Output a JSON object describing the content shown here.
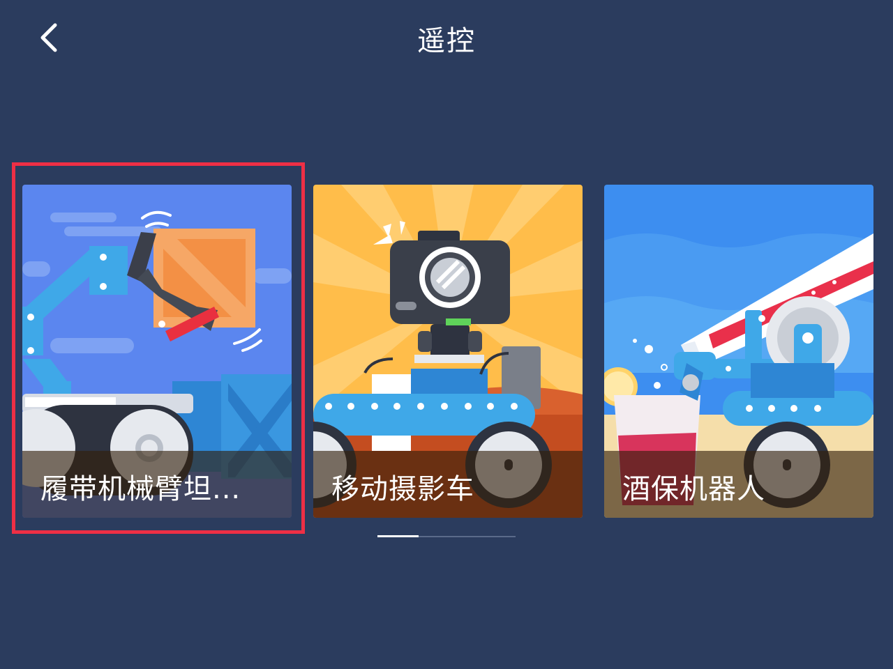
{
  "header": {
    "title": "遥控",
    "back_icon": "chevron-left-icon"
  },
  "cards": [
    {
      "title": "履带机械臂坦...",
      "illustration": "tracked-arm-tank-robot",
      "selected": true
    },
    {
      "title": "移动摄影车",
      "illustration": "camera-vehicle"
    },
    {
      "title": "酒保机器人",
      "illustration": "bartender-robot"
    }
  ],
  "pager": {
    "current_page": 1,
    "total_pages": 3
  },
  "colors": {
    "background": "#2b3c5e",
    "selection": "#ee2f45",
    "indicator_active": "#ffffff",
    "indicator_inactive": "#5b6b8a"
  }
}
